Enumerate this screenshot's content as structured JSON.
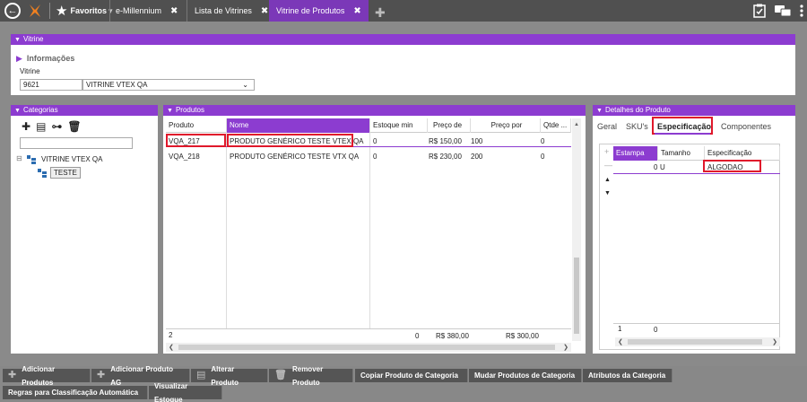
{
  "topbar": {
    "favorites_label": "Favoritos",
    "tabs": [
      {
        "label": "e-Millennium",
        "active": false
      },
      {
        "label": "Lista de Vitrines",
        "active": false
      },
      {
        "label": "Vitrine de Produtos",
        "active": true
      }
    ],
    "close_glyph": "✖",
    "accent": "#7b38b8"
  },
  "vitrine_panel": {
    "header": "Vitrine",
    "info_label": "Informações",
    "field_label": "Vitrine",
    "code": "9621",
    "name": "VITRINE VTEX QA"
  },
  "categorias_panel": {
    "header": "Categorias",
    "tree": {
      "root": "VITRINE VTEX QA",
      "child": "TESTE"
    }
  },
  "produtos_panel": {
    "header": "Produtos",
    "columns": [
      "Produto",
      "Nome",
      "Estoque min",
      "Preço de",
      "Preço por",
      "Qtde ..."
    ],
    "rows": [
      {
        "produto": "VQA_217",
        "nome": "PRODUTO GENÉRICO TESTE VTEX QA",
        "estoque": "0",
        "preco_de": "R$ 150,00",
        "preco_por": "100",
        "qtde": "0"
      },
      {
        "produto": "VQA_218",
        "nome": "PRODUTO GENÉRICO TESTE VTX QA",
        "estoque": "0",
        "preco_de": "R$ 230,00",
        "preco_por": "200",
        "qtde": "0"
      }
    ],
    "footer": {
      "count": "2",
      "estoque": "0",
      "preco_de": "R$ 380,00",
      "preco_por": "R$ 300,00"
    }
  },
  "detalhes_panel": {
    "header": "Detalhes do Produto",
    "tabs": [
      "Geral",
      "SKU's",
      "Especificação",
      "Componentes"
    ],
    "columns": [
      "Estampa",
      "Tamanho",
      "Especificação"
    ],
    "row": {
      "estampa": "0",
      "tamanho": "U",
      "especificacao": "ALGODAO"
    },
    "footer": {
      "count": "1",
      "estampa": "0"
    }
  },
  "buttons": {
    "row1": [
      "Adicionar Produtos",
      "Adicionar Produto AG",
      "Alterar Produto",
      "Remover Produto",
      "Copiar Produto de Categoria",
      "Mudar Produtos de Categoria",
      "Atributos da Categoria"
    ],
    "row2": [
      "Regras para Classificação Automática",
      "Visualizar Estoque"
    ]
  }
}
